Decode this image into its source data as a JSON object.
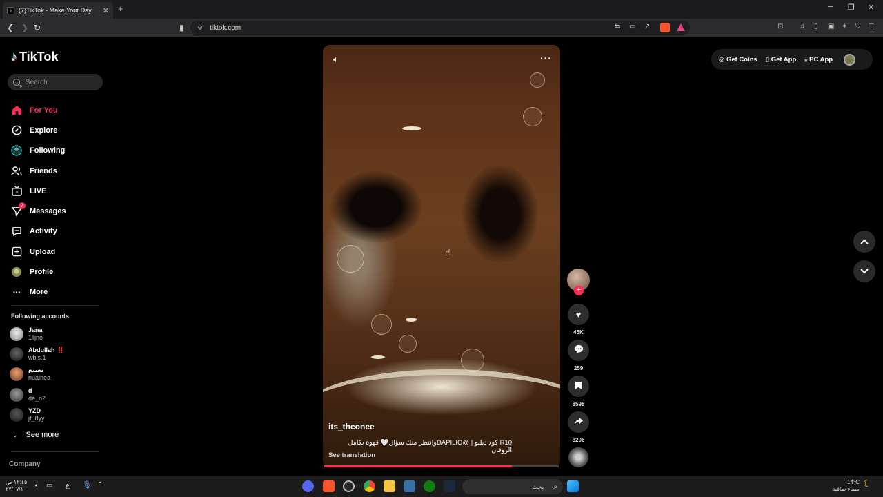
{
  "browser": {
    "tab_title": "(7)TikTok - Make Your Day",
    "url": "tiktok.com"
  },
  "sidebar": {
    "logo_text": "TikTok",
    "search_placeholder": "Search",
    "nav": [
      {
        "label": "For You",
        "icon": "home-icon",
        "active": true
      },
      {
        "label": "Explore",
        "icon": "compass-icon"
      },
      {
        "label": "Following",
        "icon": "following-avatar-icon"
      },
      {
        "label": "Friends",
        "icon": "friends-icon"
      },
      {
        "label": "LIVE",
        "icon": "live-tv-icon"
      },
      {
        "label": "Messages",
        "icon": "paper-plane-icon",
        "badge": "7"
      },
      {
        "label": "Activity",
        "icon": "activity-icon"
      },
      {
        "label": "Upload",
        "icon": "upload-plus-icon"
      },
      {
        "label": "Profile",
        "icon": "profile-avatar-icon"
      },
      {
        "label": "More",
        "icon": "more-dots-icon"
      }
    ],
    "following_title": "Following accounts",
    "accounts": [
      {
        "name": "Jana",
        "handle": "1lljno"
      },
      {
        "name": "Abdullah ‼️",
        "handle": "wbls.1"
      },
      {
        "name": "نعينع",
        "handle": "nuainea"
      },
      {
        "name": "d",
        "handle": "de_n2"
      },
      {
        "name": "YZD",
        "handle": "jf_8yy"
      }
    ],
    "see_more": "See more",
    "company": "Company"
  },
  "video": {
    "username": "its_theonee",
    "description": "R10 كود ديليو | @DAPILIOوانتظر منك سؤال🤍 قهوة بكامل الروقان",
    "see_translation": "See translation",
    "progress": 0.8
  },
  "actions": {
    "likes": "45K",
    "comments": "259",
    "saves": "8598",
    "shares": "8206"
  },
  "topbar": {
    "get_coins": "Get Coins",
    "get_app": "Get App",
    "pc_app": "PC App"
  },
  "taskbar": {
    "search_text": "بحث",
    "time": "١٢:٤٥ ص",
    "date": "٢٧/٠٧/١٠",
    "weather_temp": "14°C",
    "weather_text": "سماء صافية",
    "lang": "ع"
  },
  "colors": {
    "accent": "#fe2c55",
    "background": "#000000"
  }
}
